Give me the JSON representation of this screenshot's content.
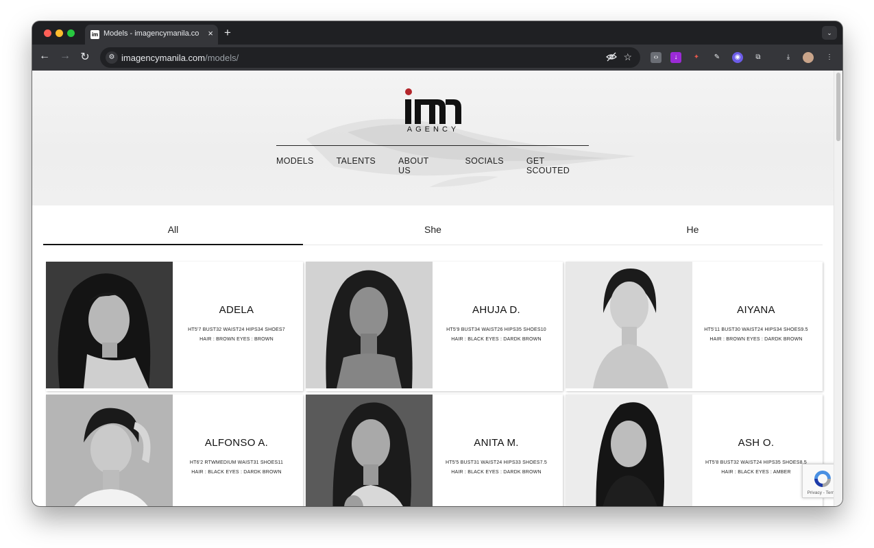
{
  "browser": {
    "tab_title": "Models - imagencymanila.com",
    "tab_favicon": "im",
    "url_domain": "imagencymanila.com",
    "url_path": "/models/",
    "new_tab_glyph": "+",
    "close_glyph": "×"
  },
  "site": {
    "logo_text": "AGENCY",
    "nav": [
      "MODELS",
      "TALENTS",
      "ABOUT US",
      "SOCIALS",
      "GET SCOUTED"
    ],
    "filters": [
      {
        "label": "All",
        "active": true
      },
      {
        "label": "She",
        "active": false
      },
      {
        "label": "He",
        "active": false
      }
    ]
  },
  "models": [
    {
      "name": "ADELA",
      "measurements": "HT5'7  BUST32  WAIST24  HIPS34  SHOES7",
      "features": "HAIR : BROWN  EYES : BROWN"
    },
    {
      "name": "AHUJA D.",
      "measurements": "HT5'9  BUST34  WAIST26  HIPS35  SHOES10",
      "features": "HAIR : BLACK  EYES : DARDK BROWN"
    },
    {
      "name": "AIYANA",
      "measurements": "HT5'11  BUST30  WAIST24  HIPS34  SHOES9.5",
      "features": "HAIR : BROWN  EYES : DARDK BROWN"
    },
    {
      "name": "ALFONSO A.",
      "measurements": "HT6'2  RTWMEDIUM  WAIST31  SHOES11",
      "features": "HAIR : BLACK  EYES : DARDK BROWN"
    },
    {
      "name": "ANITA M.",
      "measurements": "HT5'5  BUST31  WAIST24  HIPS33  SHOES7.5",
      "features": "HAIR : BLACK  EYES : DARDK BROWN"
    },
    {
      "name": "ASH O.",
      "measurements": "HT5'8  BUST32  WAIST24  HIPS35  SHOES8.5",
      "features": "HAIR : BLACK  EYES : AMBER"
    }
  ],
  "recaptcha": {
    "links": "Privacy - Terms"
  },
  "colors": {
    "logo_dot": "#b3262b",
    "chrome_dark": "#1f2023",
    "toolbar": "#35363a"
  }
}
